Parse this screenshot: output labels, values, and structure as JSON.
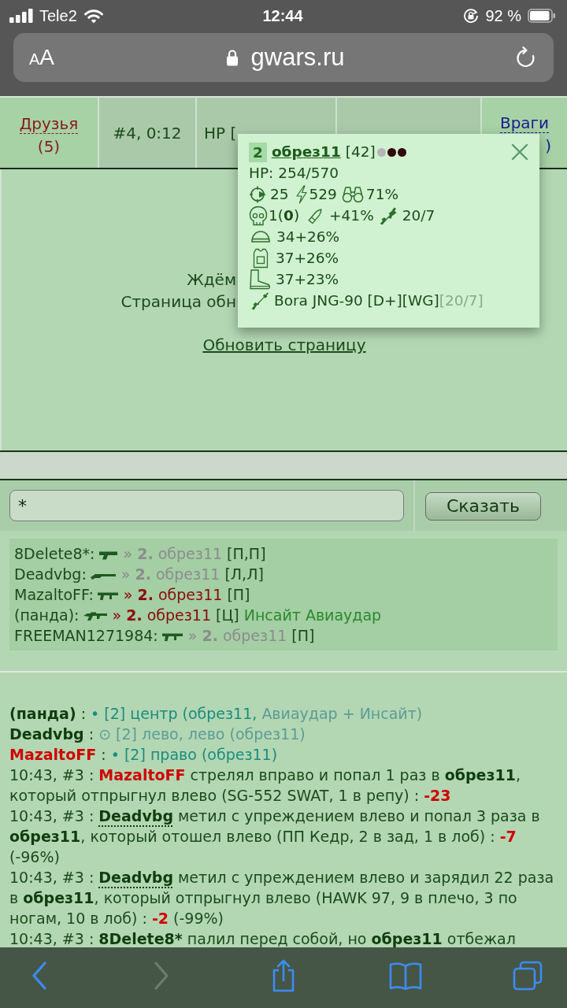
{
  "status_bar": {
    "carrier": "Tele2",
    "time": "12:44",
    "battery": "92 %"
  },
  "address_bar": {
    "text_size": "AA",
    "url": "gwars.ru"
  },
  "top_bar": {
    "friends": {
      "label": "Друзья",
      "count": "(5)"
    },
    "turn": "#4, 0:12",
    "hp": "HP [",
    "enemies": {
      "label": "Враги",
      "count": ")"
    }
  },
  "waiting": {
    "lines": [
      "Ждём",
      "Страница обн"
    ],
    "refresh_link": "Обновить страницу"
  },
  "chat": {
    "value": "*",
    "button": "Сказать"
  },
  "targets": [
    {
      "kind": "pistol",
      "shooter": "8Delete8*:",
      "target": "» **2.** обрез11",
      "color": "#8c8c8c",
      "direction": "[П,П]"
    },
    {
      "kind": "shotgun",
      "shooter": "Deadvbg:",
      "target": "» **2.** обрез11",
      "color": "#8c8c8c",
      "direction": "[Л,Л]"
    },
    {
      "kind": "smg",
      "shooter": "MazaltoFF:",
      "target": "» **2.** обрез11",
      "color": "#8b0a0a",
      "direction": "[П]"
    },
    {
      "kind": "rifle",
      "shooter": "(панда):",
      "target": "» **2.** обрез11",
      "color": "#8b0a0a",
      "direction": "[Ц]",
      "note": "Инсайт Авиаудар"
    },
    {
      "kind": "smg",
      "shooter": "FREEMAN1271984:",
      "target": "» **2.** обрез11",
      "color": "#8c8c8c",
      "direction": "[П]"
    }
  ],
  "popup": {
    "badge": "2",
    "name": "обрез11",
    "level": "[42]",
    "dots": [
      {
        "color": "#b5b5b5"
      },
      {
        "color": "#2e0808"
      },
      {
        "color": "#2e0808"
      }
    ],
    "hp": "HP: 254/570",
    "accuracy": "25",
    "energy": "529",
    "vision": "71%",
    "kills": "1(**0**)",
    "ammo_bonus": "+41%",
    "weapon_stat": "20/7",
    "helmet": "34+26%",
    "armor": "37+26%",
    "boots": "37+23%",
    "weapon": {
      "name": "Bora JNG-90 [D+][WG]",
      "ammo": "[20/7]"
    }
  },
  "log": [
    {
      "segments": [
        {
          "kind": "name",
          "text": "(панда)"
        },
        {
          "kind": "plain",
          "text": " : "
        },
        {
          "kind": "aim",
          "text": "• [2] центр (обрез11, "
        },
        {
          "kind": "aim_dim",
          "text": "Авиаудар + Инсайт)"
        }
      ]
    },
    {
      "segments": [
        {
          "kind": "name",
          "text": "Deadvbg"
        },
        {
          "kind": "plain",
          "text": " : "
        },
        {
          "kind": "aim_dim",
          "text": "⊙ [2] лево, лево (обрез11)"
        }
      ]
    },
    {
      "segments": [
        {
          "kind": "name_red",
          "text": "MazaltoFF"
        },
        {
          "kind": "plain",
          "text": " : "
        },
        {
          "kind": "aim",
          "text": "• [2] право (обрез11)"
        }
      ]
    },
    {
      "segments": [
        {
          "kind": "plain",
          "text": "10:43, #3 : "
        },
        {
          "kind": "name_red",
          "text": "MazaltoFF"
        },
        {
          "kind": "plain",
          "text": " стрелял вправо и попал 1 раз в **обрез11**, который отпрыгнул влево (SG-552 SWAT, 1 в репу) : "
        },
        {
          "kind": "damage",
          "text": "-23"
        }
      ]
    },
    {
      "segments": [
        {
          "kind": "plain",
          "text": "10:43, #3 : "
        },
        {
          "kind": "name_dotted",
          "text": "Deadvbg"
        },
        {
          "kind": "plain",
          "text": " метил с упреждением влево и попал 3 раза в **обрез11**, который отошел влево (ПП Кедр, 2 в зад, 1 в лоб) : "
        },
        {
          "kind": "damage",
          "text": "-7"
        },
        {
          "kind": "plain",
          "text": " (-96%)"
        }
      ]
    },
    {
      "segments": [
        {
          "kind": "plain",
          "text": "10:43, #3 : "
        },
        {
          "kind": "name_dotted",
          "text": "Deadvbg"
        },
        {
          "kind": "plain",
          "text": " метил с упреждением влево и зарядил 22 раза в **обрез11**, который отпрыгнул влево (HAWK 97, 9 в плечо, 3 по ногам, 10 в лоб) : "
        },
        {
          "kind": "damage",
          "text": "-2"
        },
        {
          "kind": "plain",
          "text": " (-99%)"
        }
      ]
    },
    {
      "segments": [
        {
          "kind": "plain",
          "text": "10:43, #3 : "
        },
        {
          "kind": "name",
          "text": "8Delete8*"
        },
        {
          "kind": "plain",
          "text": " палил перед собой, но **обрез11** отбежал"
        }
      ]
    }
  ],
  "toolbar": [
    {
      "kind": "back",
      "disabled": false
    },
    {
      "kind": "forward",
      "disabled": true
    },
    {
      "kind": "share",
      "disabled": false
    },
    {
      "kind": "bookmarks",
      "disabled": false
    },
    {
      "kind": "tabs",
      "disabled": false
    }
  ]
}
